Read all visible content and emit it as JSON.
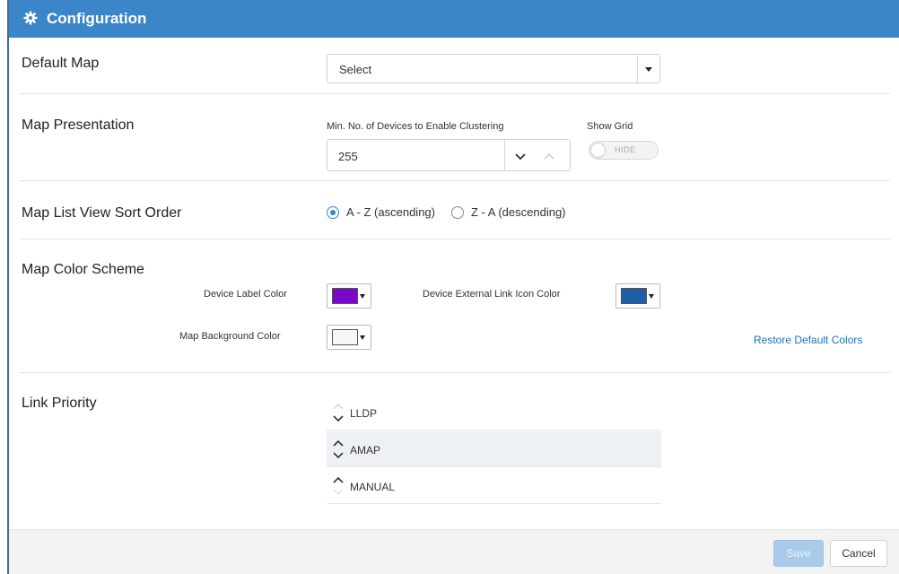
{
  "header": {
    "title": "Configuration",
    "icon": "gear-icon"
  },
  "sections": {
    "default_map": {
      "label": "Default Map",
      "select_value": "Select"
    },
    "map_presentation": {
      "label": "Map Presentation",
      "clustering_label": "Min. No. of Devices to Enable Clustering",
      "clustering_value": "255",
      "show_grid_label": "Show Grid",
      "show_grid_state": "HIDE"
    },
    "sort_order": {
      "label": "Map List View Sort Order",
      "options": [
        "A - Z (ascending)",
        "Z - A (descending)"
      ],
      "selected": "A - Z (ascending)"
    },
    "color_scheme": {
      "label": "Map Color Scheme",
      "device_label_color_label": "Device Label Color",
      "device_label_color": "#7a08c8",
      "external_link_icon_color_label": "Device External Link Icon Color",
      "external_link_icon_color": "#1e5fa8",
      "background_color_label": "Map Background Color",
      "background_color": "#f7f7f7",
      "restore_label": "Restore Default Colors"
    },
    "link_priority": {
      "label": "Link Priority",
      "items": [
        "LLDP",
        "AMAP",
        "MANUAL"
      ]
    }
  },
  "footer": {
    "save_label": "Save",
    "cancel_label": "Cancel"
  }
}
